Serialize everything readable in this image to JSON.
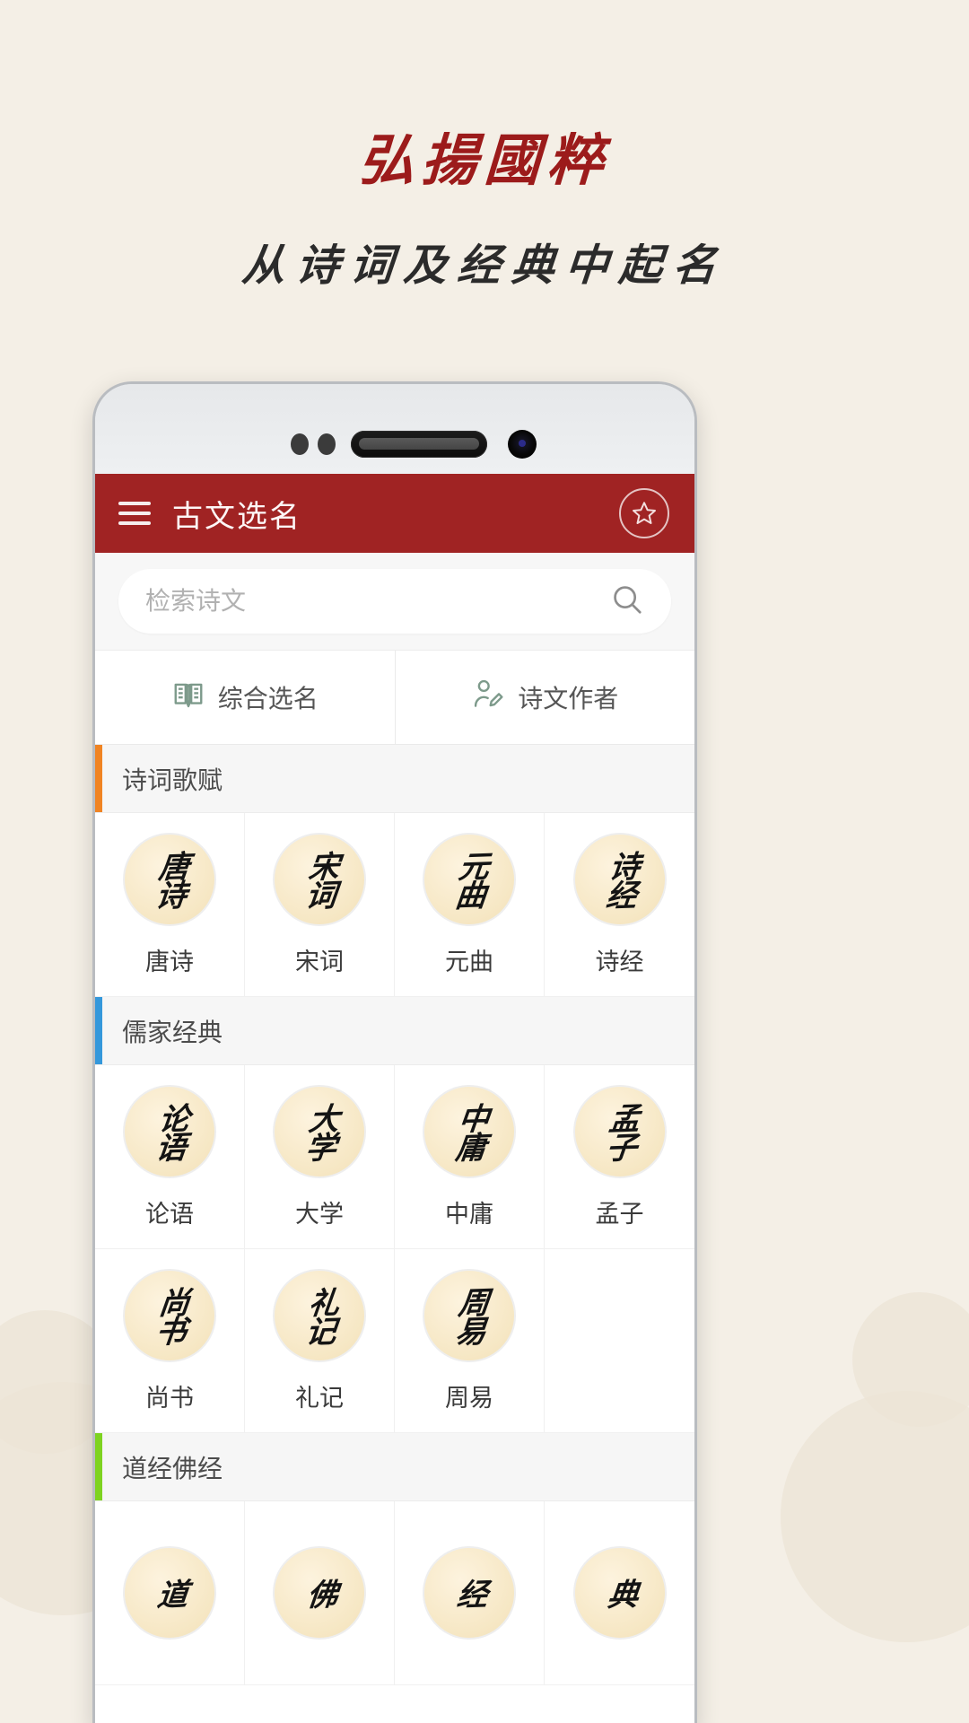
{
  "promo": {
    "headline": "弘揚國粹",
    "subhead": "从诗词及经典中起名",
    "headline_color": "#9c1b1b",
    "background_color": "#f4efe6"
  },
  "app": {
    "header": {
      "menu_icon": "hamburger-icon",
      "title": "古文选名",
      "favorite_icon": "star-icon",
      "accent_color": "#a02323"
    },
    "search": {
      "placeholder": "检索诗文",
      "value": "",
      "icon": "search-icon"
    },
    "tabs": [
      {
        "label": "综合选名",
        "icon": "open-book-icon",
        "active": true
      },
      {
        "label": "诗文作者",
        "icon": "person-pen-icon",
        "active": false
      }
    ],
    "sections": [
      {
        "title": "诗词歌赋",
        "accent": "#f08423",
        "items": [
          {
            "label": "唐诗",
            "seal": "唐诗"
          },
          {
            "label": "宋词",
            "seal": "宋词"
          },
          {
            "label": "元曲",
            "seal": "元曲"
          },
          {
            "label": "诗经",
            "seal": "诗经"
          }
        ]
      },
      {
        "title": "儒家经典",
        "accent": "#3498db",
        "items": [
          {
            "label": "论语",
            "seal": "论语"
          },
          {
            "label": "大学",
            "seal": "大学"
          },
          {
            "label": "中庸",
            "seal": "中庸"
          },
          {
            "label": "孟子",
            "seal": "孟子"
          },
          {
            "label": "尚书",
            "seal": "尚书"
          },
          {
            "label": "礼记",
            "seal": "礼记"
          },
          {
            "label": "周易",
            "seal": "周易"
          },
          {
            "label": "",
            "seal": ""
          }
        ]
      },
      {
        "title": "道经佛经",
        "accent": "#7ed321",
        "items": [
          {
            "label": "",
            "seal": "道"
          },
          {
            "label": "",
            "seal": "佛"
          },
          {
            "label": "",
            "seal": "经"
          },
          {
            "label": "",
            "seal": "典"
          }
        ]
      }
    ]
  }
}
